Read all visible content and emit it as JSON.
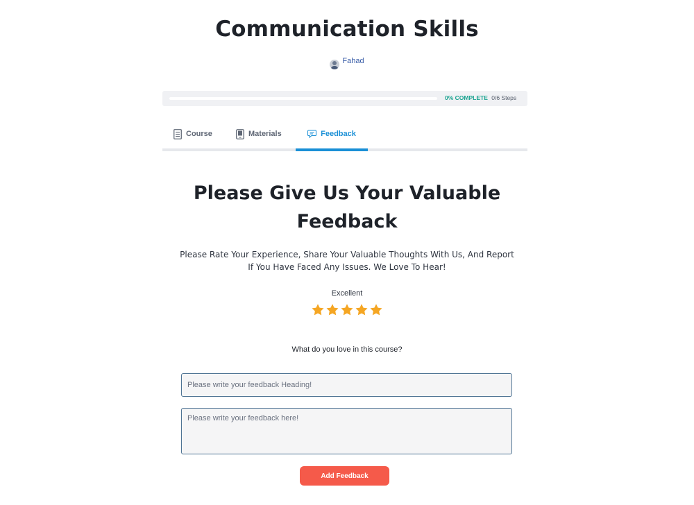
{
  "course": {
    "title": "Communication Skills",
    "author": "Fahad"
  },
  "progress": {
    "percent": 0,
    "label": "0% COMPLETE",
    "steps": "0/6 Steps",
    "fill_color": "#19a38f"
  },
  "tabs": [
    {
      "label": "Course",
      "icon": "document-icon",
      "active": false
    },
    {
      "label": "Materials",
      "icon": "phone-icon",
      "active": false
    },
    {
      "label": "Feedback",
      "icon": "chat-icon",
      "active": true
    }
  ],
  "feedback": {
    "headline": "Please Give Us Your Valuable Feedback",
    "subtext": "Please Rate Your Experience, Share Your Valuable Thoughts With Us, And Report If You Have Faced Any Issues. We Love To Hear!",
    "rating_label": "Excellent",
    "rating": 5,
    "rating_max": 5,
    "question": "What do you love in this course?",
    "heading_placeholder": "Please write your feedback Heading!",
    "body_placeholder": "Please write your feedback here!",
    "submit_label": "Add Feedback"
  },
  "colors": {
    "accent": "#1a8fd6",
    "star": "#f5a623",
    "button": "#f55a4a",
    "progress": "#19a38f"
  }
}
